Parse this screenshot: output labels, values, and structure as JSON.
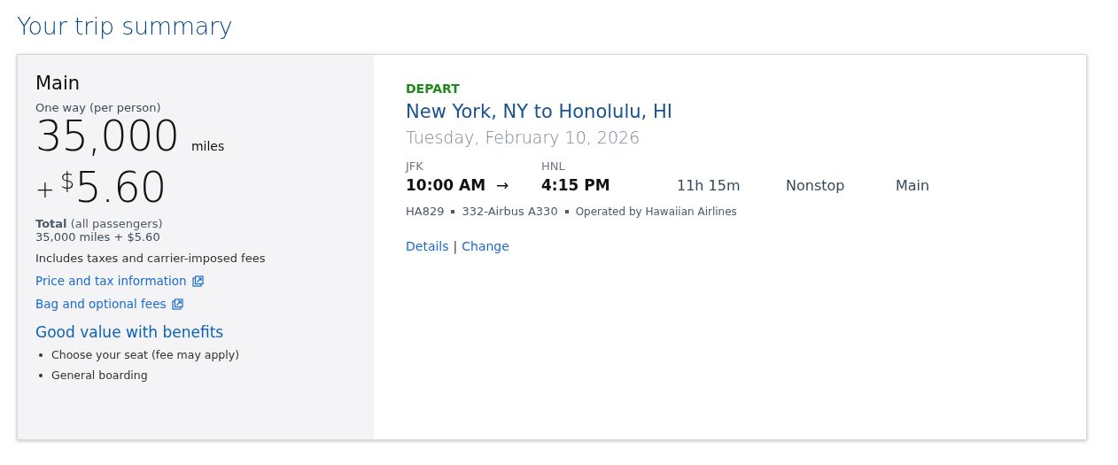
{
  "page_title": "Your trip summary",
  "fare": {
    "cabin": "Main",
    "trip_type": "One way (per person)",
    "miles": "35,000",
    "miles_unit": "miles",
    "plus": "+",
    "currency": "$",
    "cash": "5.60",
    "total_label": "**Total** (all passengers)",
    "total_value": "35,000 miles + $5.60",
    "taxes_note": "Includes taxes and carrier-imposed fees",
    "links": [
      {
        "label": "Price and tax information"
      },
      {
        "label": "Bag and optional fees"
      }
    ],
    "benefits_title": "Good value with benefits",
    "benefits": [
      "Choose your seat (fee may apply)",
      "General boarding"
    ]
  },
  "flight": {
    "direction": "DEPART",
    "route": "New York, NY to Honolulu, HI",
    "date": "Tuesday, February 10, 2026",
    "origin": "JFK",
    "destination": "HNL",
    "depart_time": "10:00 AM",
    "arrow": "→",
    "arrive_time": "4:15 PM",
    "duration": "11h 15m",
    "stops": "Nonstop",
    "cabin": "Main",
    "info": [
      {
        "text": "HA829"
      },
      {
        "text": "332-Airbus A330"
      },
      {
        "text": "Operated by Hawaiian Airlines",
        "kind": "operator"
      }
    ],
    "actions": [
      {
        "label": "Details"
      },
      {
        "label": "Change"
      }
    ],
    "action_separator": "|"
  }
}
